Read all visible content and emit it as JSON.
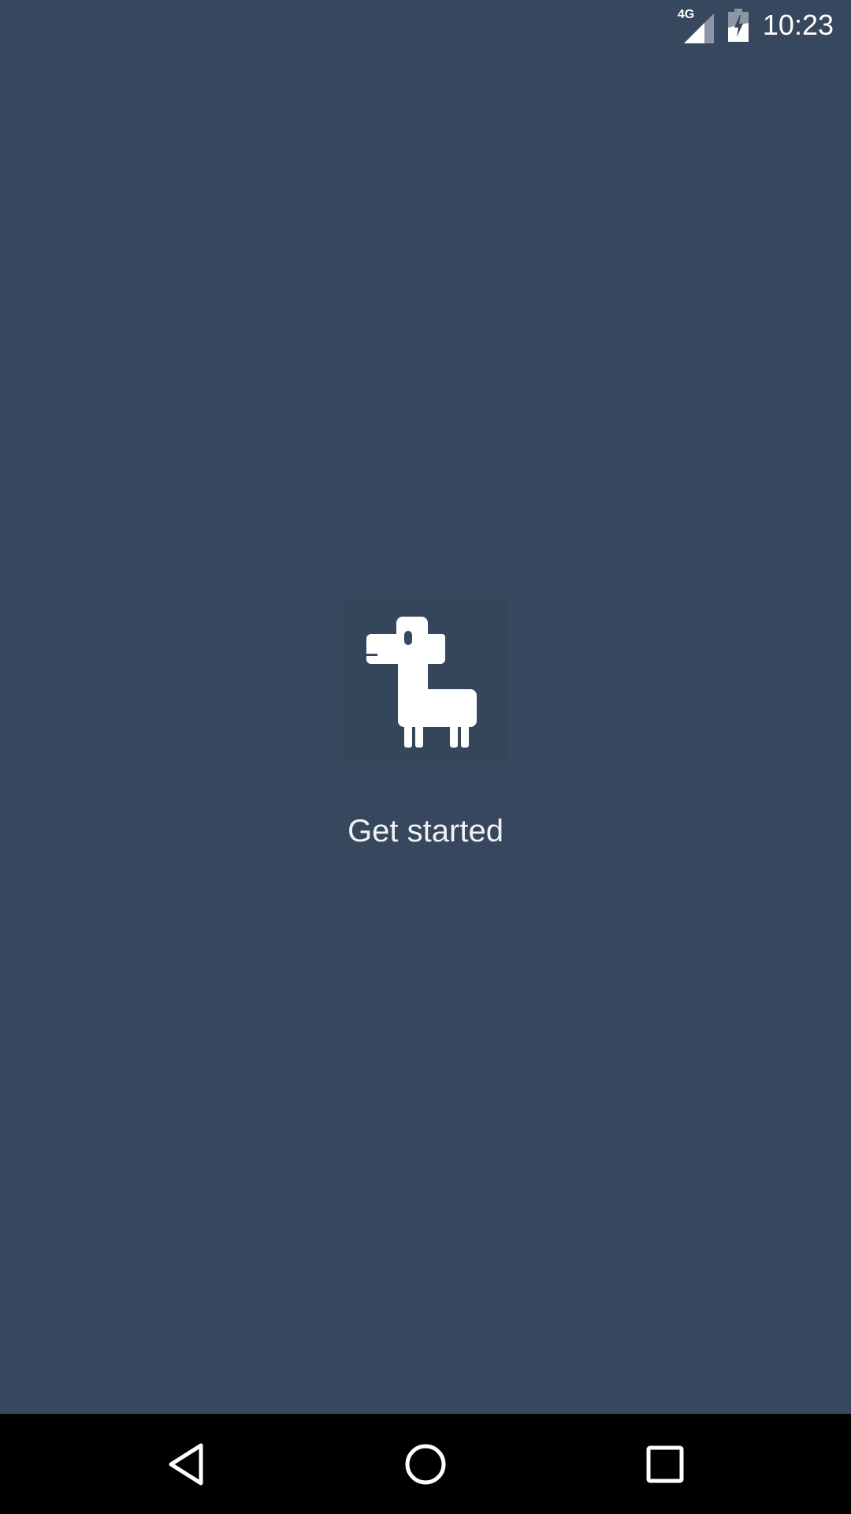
{
  "status_bar": {
    "network_type": "4G",
    "time": "10:23",
    "signal_icon": "signal-icon",
    "battery_icon": "battery-charging-icon"
  },
  "main": {
    "logo_icon": "llama-logo-icon",
    "get_started_label": "Get started"
  },
  "nav_bar": {
    "back_icon": "back-icon",
    "home_icon": "home-icon",
    "recents_icon": "recents-icon"
  },
  "colors": {
    "background": "#37475d",
    "logo_box": "#35455a",
    "text": "#f1f3f6",
    "nav_bar": "#000000"
  }
}
